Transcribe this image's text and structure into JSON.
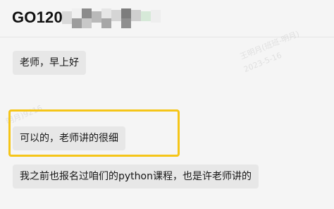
{
  "header": {
    "title": "GO1204",
    "redaction_colors": [
      "#d9d9d9",
      "#9d9d9d",
      "#8b8b8b",
      "#c8c8c8",
      "#7d7d7d",
      "#b9b9b9",
      "#d6e9d8",
      "#eeeeee"
    ]
  },
  "chat": {
    "messages": [
      {
        "text": "老师，早上好"
      },
      {
        "text": "可以的，老师讲的很细"
      },
      {
        "text": "我之前也报名过咱们的python课程，也是许老师讲的"
      }
    ]
  },
  "watermark": {
    "name": "王明月(班班-明月)",
    "date": "2023-5-16",
    "partial_1": "明月)9216",
    "partial_2": "2023-5-16"
  },
  "highlight": {
    "color": "#f5c518"
  }
}
